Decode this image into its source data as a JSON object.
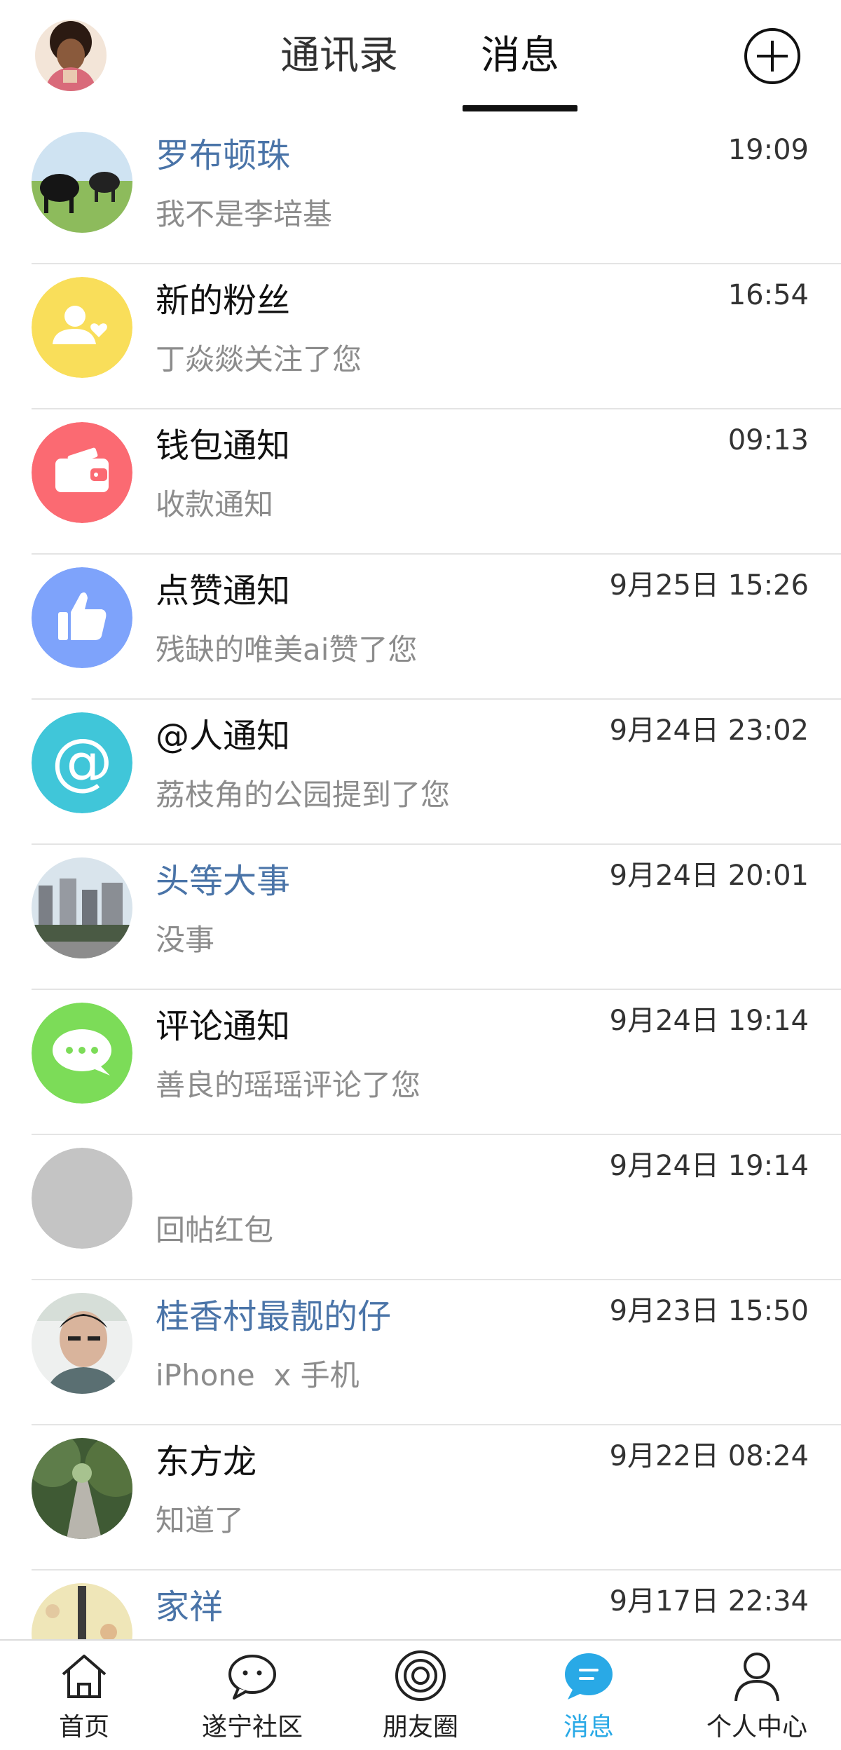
{
  "header": {
    "tabs": [
      {
        "label": "通讯录"
      },
      {
        "label": "消息"
      }
    ],
    "active_tab": "消息",
    "add_icon": "plus-circle-icon"
  },
  "conversations": [
    {
      "name": "罗布顿珠",
      "time": "19:09",
      "message": "我不是李培基",
      "name_color": "blue",
      "avatar": "photo-yaks"
    },
    {
      "name": "新的粉丝",
      "time": "16:54",
      "message": "丁焱燚关注了您",
      "name_color": "black",
      "avatar": "new-follower-icon"
    },
    {
      "name": "钱包通知",
      "time": "09:13",
      "message": "收款通知",
      "name_color": "black",
      "avatar": "wallet-icon"
    },
    {
      "name": "点赞通知",
      "time": "9月25日 15:26",
      "message": "残缺的唯美ai赞了您",
      "name_color": "black",
      "avatar": "thumbs-up-icon"
    },
    {
      "name": "@人通知",
      "time": "9月24日 23:02",
      "message": "荔枝角的公园提到了您",
      "name_color": "black",
      "avatar": "at-icon"
    },
    {
      "name": "头等大事",
      "time": "9月24日 20:01",
      "message": "没事",
      "name_color": "blue",
      "avatar": "photo-city"
    },
    {
      "name": "评论通知",
      "time": "9月24日 19:14",
      "message": "善良的瑶瑶评论了您",
      "name_color": "black",
      "avatar": "comment-icon"
    },
    {
      "name": "",
      "time": "9月24日 19:14",
      "message": "回帖红包",
      "name_color": "black",
      "avatar": "blank-gray"
    },
    {
      "name": "桂香村最靓的仔",
      "time": "9月23日 15:50",
      "message": "iPhone  x 手机",
      "name_color": "blue",
      "avatar": "photo-man"
    },
    {
      "name": "东方龙",
      "time": "9月22日 08:24",
      "message": "知道了",
      "name_color": "black",
      "avatar": "photo-path"
    },
    {
      "name": "家祥",
      "time": "9月17日 22:34",
      "message": "",
      "name_color": "blue",
      "avatar": "photo-tower"
    }
  ],
  "bottom_nav": [
    {
      "label": "首页",
      "icon": "home-icon"
    },
    {
      "label": "遂宁社区",
      "icon": "chat-bubble-icon"
    },
    {
      "label": "朋友圈",
      "icon": "moments-icon"
    },
    {
      "label": "消息",
      "icon": "message-icon",
      "active": true
    },
    {
      "label": "个人中心",
      "icon": "person-icon"
    }
  ],
  "colors": {
    "accent": "#29a9e6",
    "name_blue": "#4a74a8",
    "follower_yellow": "#f9de5a",
    "wallet_red": "#fb6a72",
    "like_blue": "#7ea3fb",
    "at_teal": "#40c6d9",
    "comment_green": "#7cdc58",
    "blank_gray": "#c4c4c4"
  }
}
